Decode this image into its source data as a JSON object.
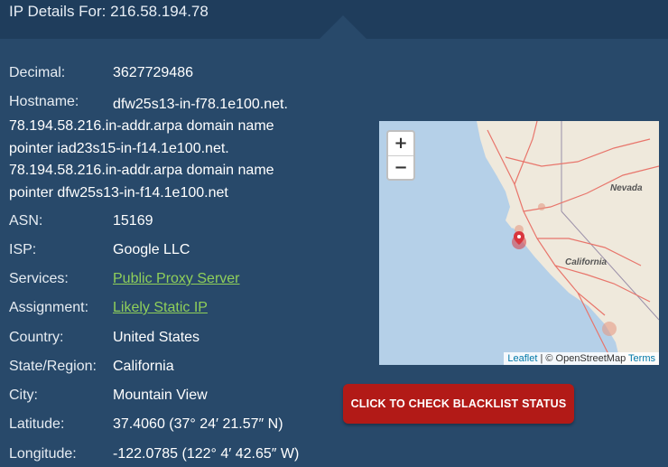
{
  "header": {
    "title": "IP Details For: 216.58.194.78"
  },
  "details": {
    "decimal": {
      "label": "Decimal:",
      "value": "3627729486"
    },
    "hostname": {
      "label": "Hostname:",
      "lines": [
        "dfw25s13-in-f78.1e100.net.",
        "78.194.58.216.in-addr.arpa domain name",
        "pointer iad23s15-in-f14.1e100.net.",
        "78.194.58.216.in-addr.arpa domain name",
        "pointer dfw25s13-in-f14.1e100.net"
      ]
    },
    "asn": {
      "label": "ASN:",
      "value": "15169"
    },
    "isp": {
      "label": "ISP:",
      "value": "Google LLC"
    },
    "services": {
      "label": "Services:",
      "value": "Public Proxy Server"
    },
    "assignment": {
      "label": "Assignment:",
      "value": "Likely Static IP"
    },
    "country": {
      "label": "Country:",
      "value": "United States"
    },
    "state": {
      "label": "State/Region:",
      "value": "California"
    },
    "city": {
      "label": "City:",
      "value": "Mountain View"
    },
    "latitude": {
      "label": "Latitude:",
      "value": "37.4060 (37° 24′ 21.57″ N)"
    },
    "longitude": {
      "label": "Longitude:",
      "value": "-122.0785 (122° 4′ 42.65″ W)"
    }
  },
  "map": {
    "zoom_in": "+",
    "zoom_out": "−",
    "labels": {
      "nevada": "Nevada",
      "california": "California"
    },
    "attribution": {
      "leaflet": "Leaflet",
      "separator": "| © OpenStreetMap",
      "terms": "Terms"
    },
    "colors": {
      "ocean": "#b5d0e8",
      "land": "#efe9dc",
      "roads": "#e8756b",
      "marker": "#d9363e"
    }
  },
  "blacklist_button": {
    "label": "CLICK TO CHECK BLACKLIST STATUS"
  },
  "colors": {
    "background": "#28496a",
    "header": "#1f3d5c",
    "link": "#8fcf5a",
    "button": "#b21a17"
  }
}
